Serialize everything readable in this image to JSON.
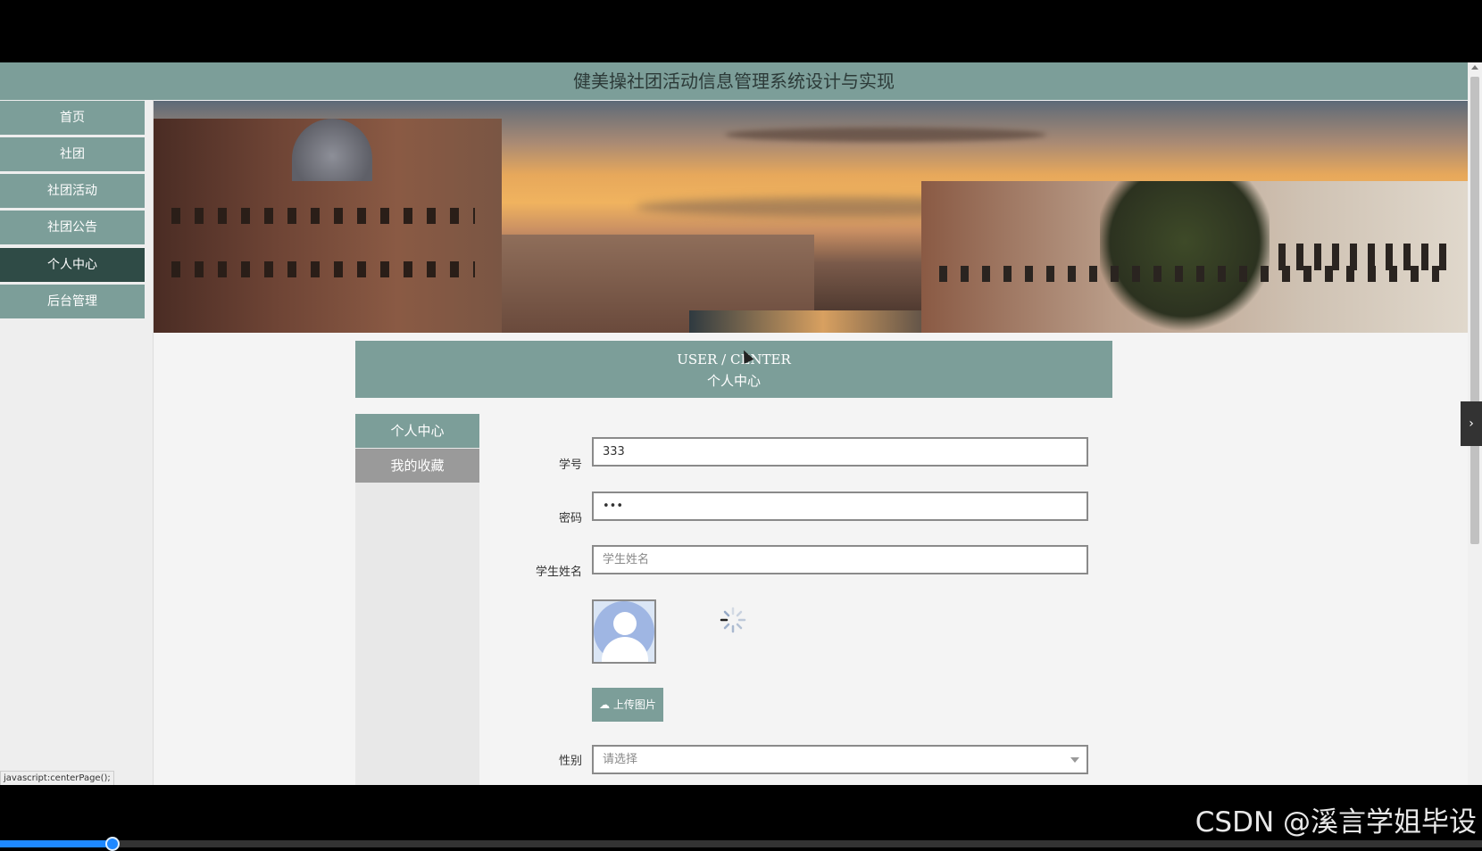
{
  "app": {
    "title": "健美操社团活动信息管理系统设计与实现"
  },
  "nav": {
    "items": [
      {
        "label": "首页",
        "active": false
      },
      {
        "label": "社团",
        "active": false
      },
      {
        "label": "社团活动",
        "active": false
      },
      {
        "label": "社团公告",
        "active": false
      },
      {
        "label": "个人中心",
        "active": true
      },
      {
        "label": "后台管理",
        "active": false
      }
    ]
  },
  "center": {
    "title_en": "USER / CENTER",
    "title_cn": "个人中心"
  },
  "subnav": {
    "items": [
      {
        "label": "个人中心",
        "active": true
      },
      {
        "label": "我的收藏",
        "active": false
      }
    ]
  },
  "form": {
    "student_id": {
      "label": "学号",
      "value": "333"
    },
    "password": {
      "label": "密码",
      "value": "•••"
    },
    "student_name": {
      "label": "学生姓名",
      "placeholder": "学生姓名"
    },
    "upload_button": "上传图片",
    "gender": {
      "label": "性别",
      "placeholder": "请选择"
    }
  },
  "status_bar": {
    "text": "javascript:centerPage();"
  },
  "video": {
    "progress_percent": 7.5
  },
  "watermark": "CSDN @溪言学姐毕设",
  "colors": {
    "accent": "#7c9e99",
    "accent_dark": "#2f4b46",
    "inactive": "#9a9a9a",
    "progress": "#1e88ff"
  },
  "icons": {
    "upload": "cloud-upload-icon",
    "spinner": "loading-spinner-icon",
    "toggle": "chevron-right-icon"
  }
}
